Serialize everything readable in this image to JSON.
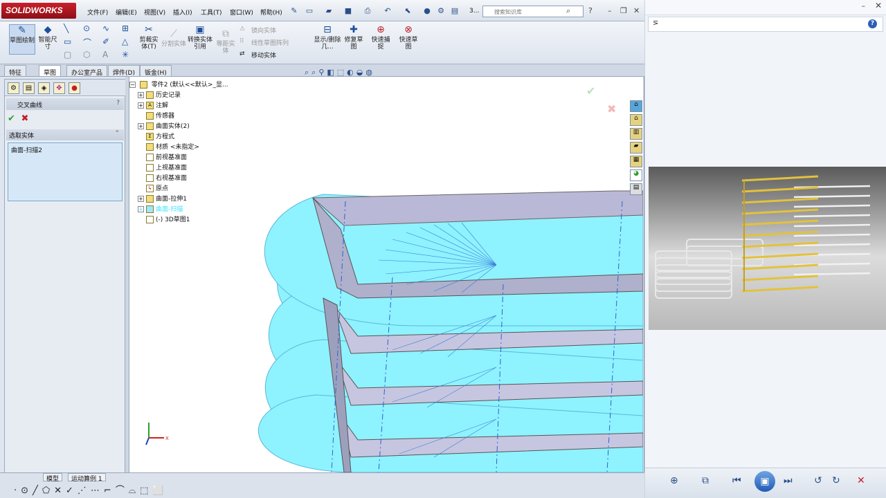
{
  "app": {
    "logo": "SOLIDWORKS"
  },
  "menus": [
    "文件(F)",
    "编辑(E)",
    "视图(V)",
    "插入(I)",
    "工具(T)",
    "窗口(W)",
    "帮助(H)"
  ],
  "quickaccess": {
    "page_indicator": "3..."
  },
  "search": {
    "placeholder": "搜索知识库"
  },
  "command_manager": {
    "sketch": "草图绘制",
    "smart_dim": "智能尺寸",
    "trim": "剪裁实体(T)",
    "convert": "转换实体引用",
    "offset": "等距实体",
    "split": "分割实体",
    "mirror": "镜向实体",
    "linear_pattern": "线性草图阵列",
    "move": "移动实体",
    "display_delete": "显示/删除几...",
    "repair": "修复草图",
    "quick_snap": "快速捕捉",
    "quick_sketch": "快速草图"
  },
  "tabs": [
    "特征",
    "草图",
    "办公室产品",
    "焊件(D)",
    "钣金(H)"
  ],
  "property_manager": {
    "title": "交叉曲线",
    "help": "?",
    "section": "选取实体",
    "selection": "曲面-扫描2"
  },
  "tree": {
    "root": "零件2 (默认<<默认>_显...",
    "items": [
      {
        "label": "历史记录",
        "icon": "history-icon",
        "expand": "+"
      },
      {
        "label": "注解",
        "icon": "annotation-icon",
        "expand": "+"
      },
      {
        "label": "传感器",
        "icon": "sensor-icon",
        "expand": ""
      },
      {
        "label": "曲面实体(2)",
        "icon": "surface-bodies-icon",
        "expand": "+"
      },
      {
        "label": "方程式",
        "icon": "equation-icon",
        "expand": ""
      },
      {
        "label": "材质 <未指定>",
        "icon": "material-icon",
        "expand": ""
      },
      {
        "label": "前视基准面",
        "icon": "plane-icon",
        "expand": ""
      },
      {
        "label": "上视基准面",
        "icon": "plane-icon",
        "expand": ""
      },
      {
        "label": "右视基准面",
        "icon": "plane-icon",
        "expand": ""
      },
      {
        "label": "原点",
        "icon": "origin-icon",
        "expand": ""
      },
      {
        "label": "曲面-拉伸1",
        "icon": "surface-extrude-icon",
        "expand": "+"
      },
      {
        "label": "曲面-扫描",
        "icon": "surface-sweep-icon",
        "expand": "+"
      },
      {
        "label": "(-) 3D草图1",
        "icon": "3d-sketch-icon",
        "expand": ""
      }
    ]
  },
  "status_tabs": [
    "模型",
    "运动算例 1"
  ],
  "viewer": {
    "address": "⋝"
  },
  "colors": {
    "highlight": "#3fe2ff",
    "surface": "#8ff2ff",
    "accent": "#1d4f9a"
  }
}
